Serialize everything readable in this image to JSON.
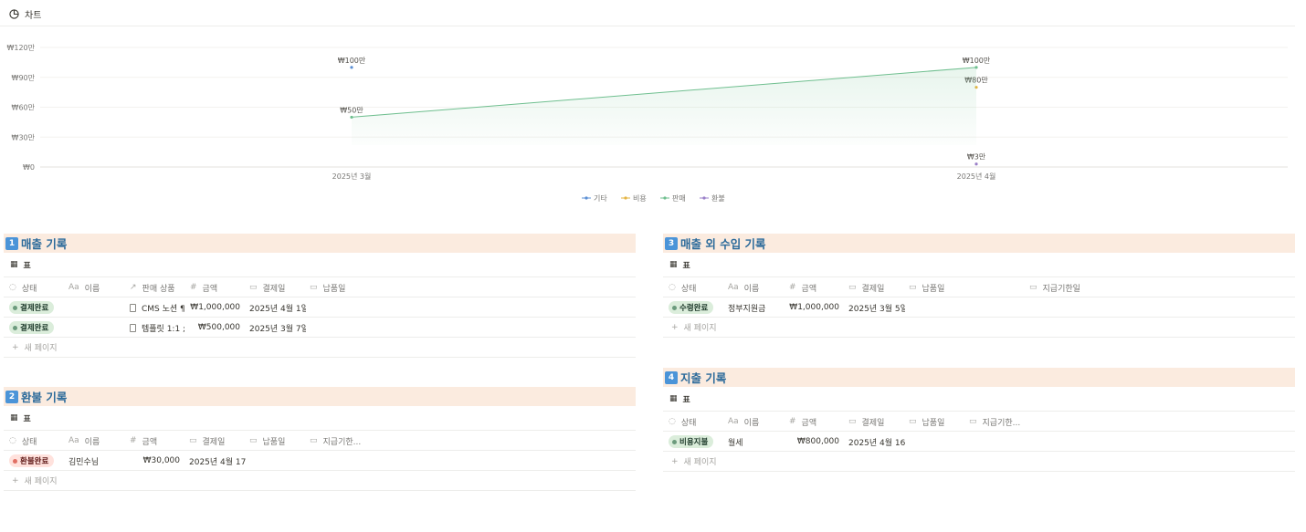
{
  "chart_header": {
    "icon": "pie-chart-icon",
    "label": "차트"
  },
  "chart_data": {
    "type": "line",
    "categories": [
      "2025년 3월",
      "2025년 4월"
    ],
    "y_ticks": [
      "₩0",
      "₩30만",
      "₩60만",
      "₩90만",
      "₩120만"
    ],
    "ylim": [
      0,
      120
    ],
    "grid": true,
    "legend_position": "bottom",
    "series": [
      {
        "name": "기타",
        "color": "#5b8fd4",
        "values": [
          100,
          null
        ],
        "labels": [
          "₩100만",
          ""
        ]
      },
      {
        "name": "비용",
        "color": "#e5b441",
        "values": [
          null,
          80
        ],
        "labels": [
          "",
          "₩80만"
        ]
      },
      {
        "name": "판매",
        "color": "#6fbf8f",
        "values": [
          50,
          100
        ],
        "labels": [
          "₩50만",
          "₩100만"
        ],
        "area": true
      },
      {
        "name": "환불",
        "color": "#9a7fc8",
        "values": [
          null,
          3
        ],
        "labels": [
          "",
          "₩3만"
        ]
      }
    ]
  },
  "view_label": "표",
  "new_page": "새 페이지",
  "sections": {
    "sales": {
      "num": "1",
      "title": "매출 기록",
      "headers": [
        "상태",
        "이름",
        "판매 상품",
        "금액",
        "결제일",
        "납품일"
      ],
      "rows": [
        {
          "status": "결제완료",
          "product": "CMS 노션 ¶",
          "amount": "₩1,000,000",
          "pay_date": "2025년 4월 1일"
        },
        {
          "status": "결제완료",
          "product": "템플릿 1:1 ;",
          "amount": "₩500,000",
          "pay_date": "2025년 3월 7일"
        }
      ]
    },
    "refund": {
      "num": "2",
      "title": "환불 기록",
      "headers": [
        "상태",
        "이름",
        "금액",
        "결제일",
        "납품일",
        "지급기한..."
      ],
      "rows": [
        {
          "status": "환불완료",
          "name": "김민수님",
          "amount": "₩30,000",
          "pay_date": "2025년 4월 17"
        }
      ]
    },
    "other_income": {
      "num": "3",
      "title": "매출 외 수입 기록",
      "headers": [
        "상태",
        "이름",
        "금액",
        "결제일",
        "납품일",
        "지급기한일"
      ],
      "rows": [
        {
          "status": "수령완료",
          "name": "정부지원금",
          "amount": "₩1,000,000",
          "pay_date": "2025년 3월 5일"
        }
      ]
    },
    "expense": {
      "num": "4",
      "title": "지출 기록",
      "headers": [
        "상태",
        "이름",
        "금액",
        "결제일",
        "납품일",
        "지급기한..."
      ],
      "rows": [
        {
          "status": "비용지불",
          "name": "월세",
          "amount": "₩800,000",
          "pay_date": "2025년 4월 16"
        }
      ]
    }
  }
}
